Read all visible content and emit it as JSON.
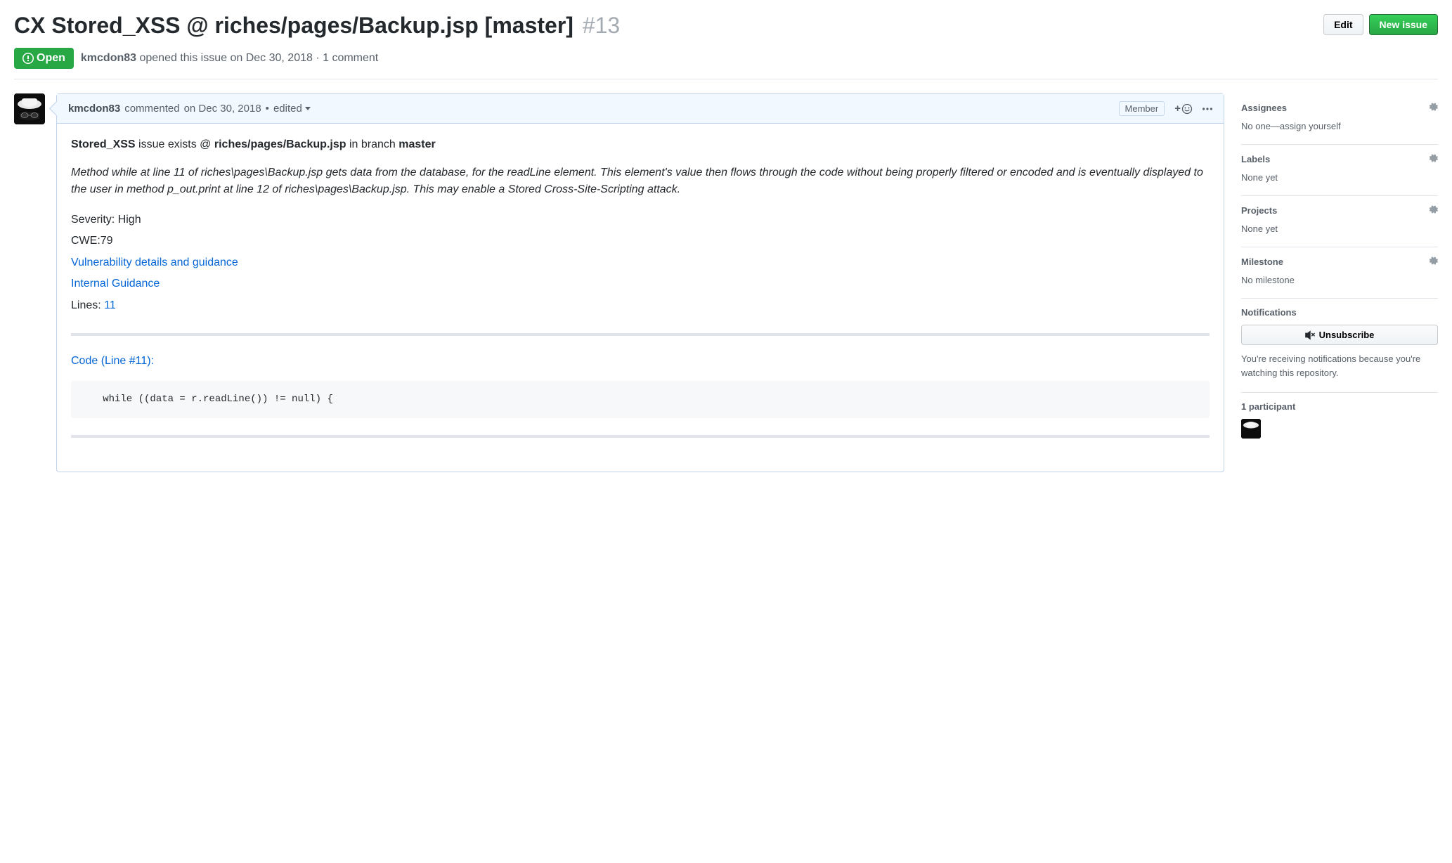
{
  "issue": {
    "title": "CX Stored_XSS @ riches/pages/Backup.jsp [master]",
    "number": "#13",
    "state": "Open",
    "author": "kmcdon83",
    "opened_text": "opened this issue on Dec 30, 2018",
    "comment_count": "1 comment"
  },
  "actions": {
    "edit": "Edit",
    "new_issue": "New issue"
  },
  "comment": {
    "author": "kmcdon83",
    "action": "commented",
    "date": "on Dec 30, 2018",
    "bullet": "•",
    "edited": "edited",
    "role": "Member",
    "body": {
      "summary_prefix": "Stored_XSS",
      "summary_mid1": " issue exists @ ",
      "summary_path": "riches/pages/Backup.jsp",
      "summary_mid2": " in branch ",
      "summary_branch": "master",
      "description": "Method while at line 11 of riches\\pages\\Backup.jsp gets data from the database, for the readLine element. This element's value then flows through the code without being properly filtered or encoded and is eventually displayed to the user in method p_out.print at line 12 of riches\\pages\\Backup.jsp. This may enable a Stored Cross-Site-Scripting attack.",
      "severity": "Severity: High",
      "cwe": "CWE:79",
      "link1": "Vulnerability details and guidance",
      "link2": "Internal Guidance",
      "lines_label": "Lines: ",
      "lines_value": "11",
      "code_link": "Code (Line #11):",
      "code": "   while ((data = r.readLine()) != null) {"
    }
  },
  "sidebar": {
    "assignees": {
      "title": "Assignees",
      "value": "No one—assign yourself"
    },
    "labels": {
      "title": "Labels",
      "value": "None yet"
    },
    "projects": {
      "title": "Projects",
      "value": "None yet"
    },
    "milestone": {
      "title": "Milestone",
      "value": "No milestone"
    },
    "notifications": {
      "title": "Notifications",
      "button": "Unsubscribe",
      "text": "You're receiving notifications because you're watching this repository."
    },
    "participants": {
      "title": "1 participant"
    }
  }
}
